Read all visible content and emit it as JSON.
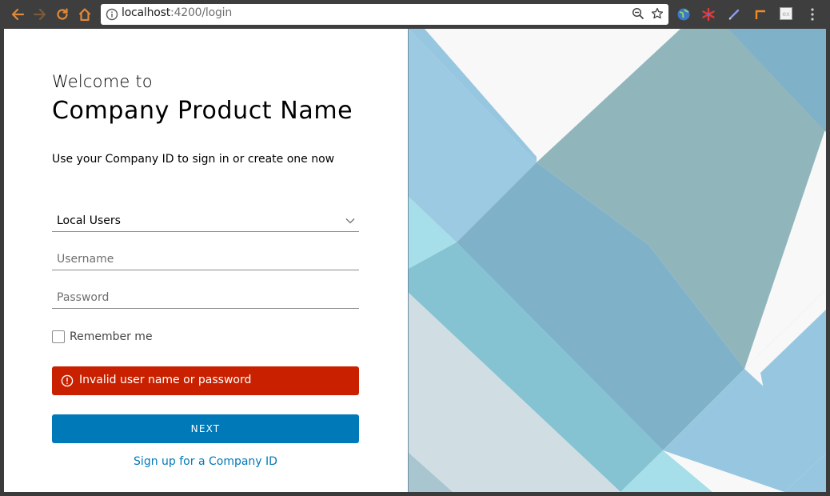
{
  "browser": {
    "url_host": "localhost",
    "url_path": ":4200/login",
    "icons": [
      "back-arrow-icon",
      "forward-arrow-icon",
      "reload-icon",
      "home-icon",
      "info-icon",
      "zoom-icon",
      "star-icon",
      "globe-extension-icon",
      "asterisk-extension-icon",
      "pen-extension-icon",
      "corner-extension-icon",
      "ex-extension-icon",
      "menu-dots-icon"
    ],
    "ex_extension_label": "ex"
  },
  "login": {
    "welcome": "Welcome to",
    "product_name": "Company Product Name",
    "subtitle": "Use your Company ID  to sign in or create one now",
    "auth_source": "Local Users",
    "username_placeholder": "Username",
    "password_placeholder": "Password",
    "remember_label": "Remember me",
    "error_message": "Invalid user name or password",
    "next_label": "NEXT",
    "signup_label": "Sign up for a Company ID"
  },
  "colors": {
    "primary": "#0079b8",
    "error": "#c92100",
    "browser_toolbar": "#3e3e3e",
    "nav_icon": "#e0883a"
  }
}
